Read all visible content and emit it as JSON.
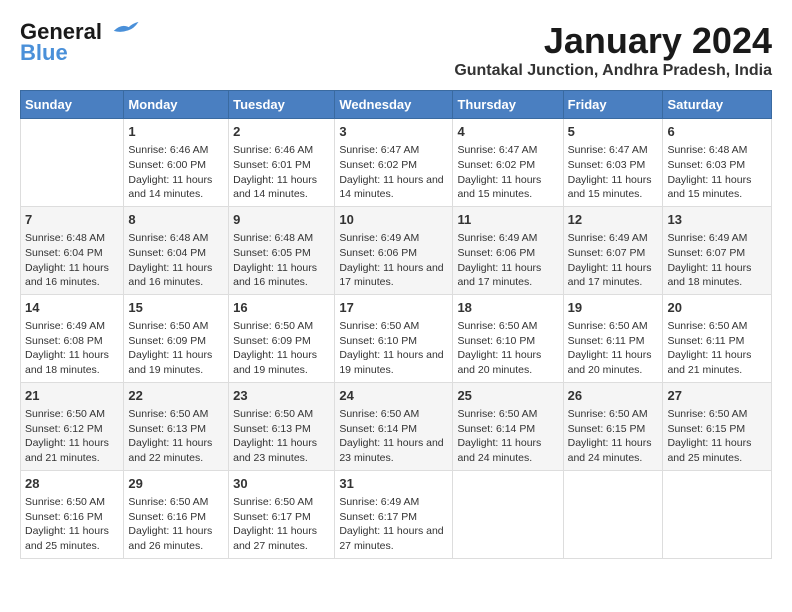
{
  "header": {
    "logo_line1": "General",
    "logo_line2": "Blue",
    "month_title": "January 2024",
    "location": "Guntakal Junction, Andhra Pradesh, India"
  },
  "days_of_week": [
    "Sunday",
    "Monday",
    "Tuesday",
    "Wednesday",
    "Thursday",
    "Friday",
    "Saturday"
  ],
  "weeks": [
    [
      {
        "day": "",
        "info": ""
      },
      {
        "day": "1",
        "info": "Sunrise: 6:46 AM\nSunset: 6:00 PM\nDaylight: 11 hours and 14 minutes."
      },
      {
        "day": "2",
        "info": "Sunrise: 6:46 AM\nSunset: 6:01 PM\nDaylight: 11 hours and 14 minutes."
      },
      {
        "day": "3",
        "info": "Sunrise: 6:47 AM\nSunset: 6:02 PM\nDaylight: 11 hours and 14 minutes."
      },
      {
        "day": "4",
        "info": "Sunrise: 6:47 AM\nSunset: 6:02 PM\nDaylight: 11 hours and 15 minutes."
      },
      {
        "day": "5",
        "info": "Sunrise: 6:47 AM\nSunset: 6:03 PM\nDaylight: 11 hours and 15 minutes."
      },
      {
        "day": "6",
        "info": "Sunrise: 6:48 AM\nSunset: 6:03 PM\nDaylight: 11 hours and 15 minutes."
      }
    ],
    [
      {
        "day": "7",
        "info": "Sunrise: 6:48 AM\nSunset: 6:04 PM\nDaylight: 11 hours and 16 minutes."
      },
      {
        "day": "8",
        "info": "Sunrise: 6:48 AM\nSunset: 6:04 PM\nDaylight: 11 hours and 16 minutes."
      },
      {
        "day": "9",
        "info": "Sunrise: 6:48 AM\nSunset: 6:05 PM\nDaylight: 11 hours and 16 minutes."
      },
      {
        "day": "10",
        "info": "Sunrise: 6:49 AM\nSunset: 6:06 PM\nDaylight: 11 hours and 17 minutes."
      },
      {
        "day": "11",
        "info": "Sunrise: 6:49 AM\nSunset: 6:06 PM\nDaylight: 11 hours and 17 minutes."
      },
      {
        "day": "12",
        "info": "Sunrise: 6:49 AM\nSunset: 6:07 PM\nDaylight: 11 hours and 17 minutes."
      },
      {
        "day": "13",
        "info": "Sunrise: 6:49 AM\nSunset: 6:07 PM\nDaylight: 11 hours and 18 minutes."
      }
    ],
    [
      {
        "day": "14",
        "info": "Sunrise: 6:49 AM\nSunset: 6:08 PM\nDaylight: 11 hours and 18 minutes."
      },
      {
        "day": "15",
        "info": "Sunrise: 6:50 AM\nSunset: 6:09 PM\nDaylight: 11 hours and 19 minutes."
      },
      {
        "day": "16",
        "info": "Sunrise: 6:50 AM\nSunset: 6:09 PM\nDaylight: 11 hours and 19 minutes."
      },
      {
        "day": "17",
        "info": "Sunrise: 6:50 AM\nSunset: 6:10 PM\nDaylight: 11 hours and 19 minutes."
      },
      {
        "day": "18",
        "info": "Sunrise: 6:50 AM\nSunset: 6:10 PM\nDaylight: 11 hours and 20 minutes."
      },
      {
        "day": "19",
        "info": "Sunrise: 6:50 AM\nSunset: 6:11 PM\nDaylight: 11 hours and 20 minutes."
      },
      {
        "day": "20",
        "info": "Sunrise: 6:50 AM\nSunset: 6:11 PM\nDaylight: 11 hours and 21 minutes."
      }
    ],
    [
      {
        "day": "21",
        "info": "Sunrise: 6:50 AM\nSunset: 6:12 PM\nDaylight: 11 hours and 21 minutes."
      },
      {
        "day": "22",
        "info": "Sunrise: 6:50 AM\nSunset: 6:13 PM\nDaylight: 11 hours and 22 minutes."
      },
      {
        "day": "23",
        "info": "Sunrise: 6:50 AM\nSunset: 6:13 PM\nDaylight: 11 hours and 23 minutes."
      },
      {
        "day": "24",
        "info": "Sunrise: 6:50 AM\nSunset: 6:14 PM\nDaylight: 11 hours and 23 minutes."
      },
      {
        "day": "25",
        "info": "Sunrise: 6:50 AM\nSunset: 6:14 PM\nDaylight: 11 hours and 24 minutes."
      },
      {
        "day": "26",
        "info": "Sunrise: 6:50 AM\nSunset: 6:15 PM\nDaylight: 11 hours and 24 minutes."
      },
      {
        "day": "27",
        "info": "Sunrise: 6:50 AM\nSunset: 6:15 PM\nDaylight: 11 hours and 25 minutes."
      }
    ],
    [
      {
        "day": "28",
        "info": "Sunrise: 6:50 AM\nSunset: 6:16 PM\nDaylight: 11 hours and 25 minutes."
      },
      {
        "day": "29",
        "info": "Sunrise: 6:50 AM\nSunset: 6:16 PM\nDaylight: 11 hours and 26 minutes."
      },
      {
        "day": "30",
        "info": "Sunrise: 6:50 AM\nSunset: 6:17 PM\nDaylight: 11 hours and 27 minutes."
      },
      {
        "day": "31",
        "info": "Sunrise: 6:49 AM\nSunset: 6:17 PM\nDaylight: 11 hours and 27 minutes."
      },
      {
        "day": "",
        "info": ""
      },
      {
        "day": "",
        "info": ""
      },
      {
        "day": "",
        "info": ""
      }
    ]
  ]
}
